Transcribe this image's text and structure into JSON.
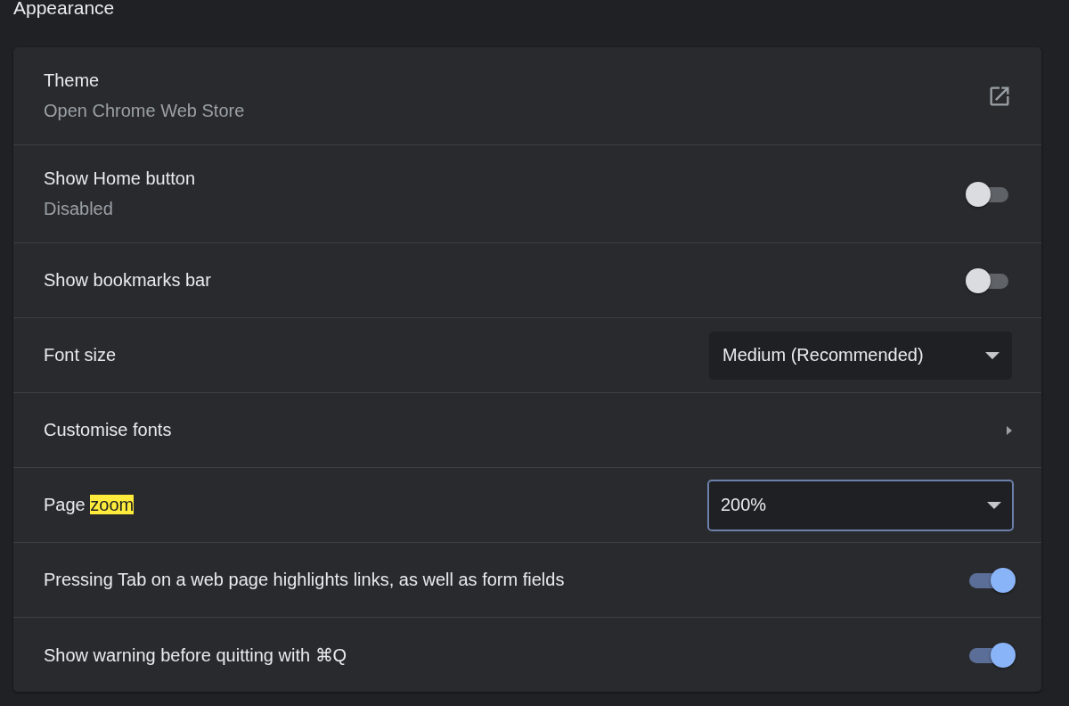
{
  "section_title": "Appearance",
  "rows": [
    {
      "kind": "link",
      "label": "Theme",
      "sublabel": "Open Chrome Web Store"
    },
    {
      "kind": "toggle",
      "label": "Show Home button",
      "sublabel": "Disabled",
      "on": false
    },
    {
      "kind": "toggle",
      "label": "Show bookmarks bar",
      "on": false
    },
    {
      "kind": "select",
      "label": "Font size",
      "value": "Medium (Recommended)",
      "focused": false
    },
    {
      "kind": "submenu",
      "label": "Customise fonts"
    },
    {
      "kind": "select",
      "label_parts": [
        {
          "text": "Page ",
          "highlighted": false
        },
        {
          "text": "zoom",
          "highlighted": true
        }
      ],
      "value": "200%",
      "focused": true
    },
    {
      "kind": "toggle",
      "label": "Pressing Tab on a web page highlights links, as well as form fields",
      "on": true
    },
    {
      "kind": "toggle",
      "label": "Show warning before quitting with ⌘Q",
      "on": true
    }
  ]
}
